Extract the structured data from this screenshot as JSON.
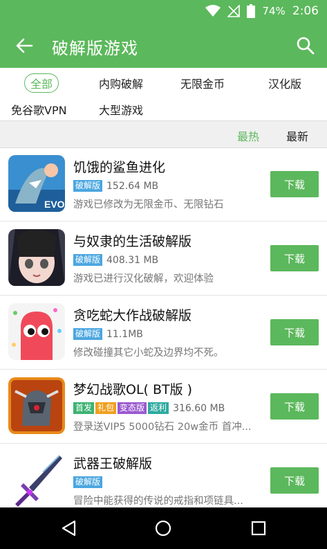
{
  "status": {
    "battery": "74%",
    "time": "2:06"
  },
  "appbar": {
    "title": "破解版游戏"
  },
  "filters": [
    "全部",
    "内购破解",
    "无限金币",
    "汉化版",
    "免谷歌VPN",
    "大型游戏"
  ],
  "sort": {
    "hot": "最热",
    "newest": "最新"
  },
  "items": [
    {
      "name": "饥饿的鲨鱼进化",
      "badges": [
        {
          "text": "破解版",
          "color": "#4aa6e0"
        }
      ],
      "size": "152.64 MB",
      "desc": "游戏已修改为无限金币、无限钻石",
      "download": "下载"
    },
    {
      "name": "与奴隶的生活破解版",
      "badges": [
        {
          "text": "破解版",
          "color": "#4aa6e0"
        }
      ],
      "size": "408.31 MB",
      "desc": "游戏已进行汉化破解，欢迎体验",
      "download": "下载"
    },
    {
      "name": "贪吃蛇大作战破解版",
      "badges": [
        {
          "text": "破解版",
          "color": "#4aa6e0"
        }
      ],
      "size": "11.1MB",
      "desc": "修改碰撞其它小蛇及边界均不死。",
      "download": "下载"
    },
    {
      "name": "梦幻战歌OL( BT版 )",
      "badges": [
        {
          "text": "首发",
          "color": "#3cb371"
        },
        {
          "text": "礼包",
          "color": "#f0a020"
        },
        {
          "text": "变态版",
          "color": "#9b59d0"
        },
        {
          "text": "返利",
          "color": "#2eaaa0"
        }
      ],
      "size": "316.60 MB",
      "desc": "登录送VIP5 5000钻石 20w金币 首冲...",
      "download": "下载"
    },
    {
      "name": "武器王破解版",
      "badges": [
        {
          "text": "破解版",
          "color": "#4aa6e0"
        }
      ],
      "size": "",
      "desc": "冒险中能获得的传说的戒指和项链具...",
      "download": "下载"
    }
  ],
  "icons": {
    "back": "arrow-left-icon",
    "search": "search-icon",
    "wifi": "wifi-icon",
    "signal": "signal-off-icon",
    "battery": "battery-icon"
  },
  "colors": {
    "primary": "#5cb85c"
  }
}
